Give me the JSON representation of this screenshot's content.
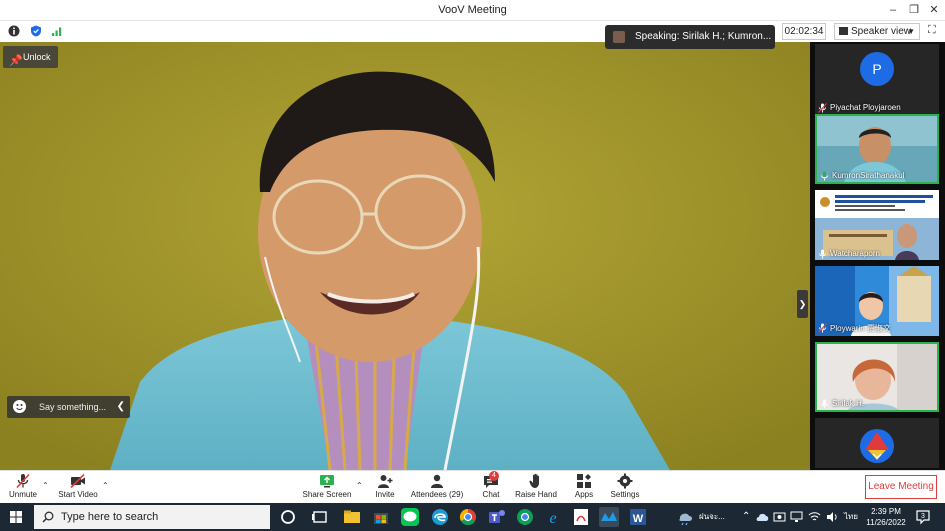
{
  "window": {
    "title": "VooV Meeting"
  },
  "topbar": {
    "speaking_text": "Speaking: Sirilak H.; Kumron...",
    "timer": "02:02:34",
    "view_mode": "Speaker view"
  },
  "main_video": {
    "unlock_label": "Unlock",
    "chat_placeholder": "Say something..."
  },
  "participants": [
    {
      "name": "Piyachat Ployjaroen",
      "avatar_letter": "P",
      "mic": "muted"
    },
    {
      "name": "KumronSirathanakul",
      "mic": "active"
    },
    {
      "name": "Watcharaporn",
      "mic": "on"
    },
    {
      "name": "Ploywarin 贾淑文",
      "mic": "muted"
    },
    {
      "name": "Sirilak H.",
      "mic": "on"
    },
    {
      "name": "",
      "mic": ""
    }
  ],
  "toolbar": {
    "unmute": "Unmute",
    "start_video": "Start Video",
    "share_screen": "Share Screen",
    "invite": "Invite",
    "attendees": "Attendees (29)",
    "chat": "Chat",
    "chat_badge": "4",
    "raise_hand": "Raise Hand",
    "apps": "Apps",
    "settings": "Settings",
    "leave": "Leave Meeting"
  },
  "taskbar": {
    "search_placeholder": "Type here to search",
    "weather": "ฝนจะ...",
    "time": "2:39 PM",
    "date": "11/26/2022",
    "lang": "ไทย",
    "notifications": "3"
  },
  "colors": {
    "accent_blue": "#1e6be6",
    "leave_red": "#e03a3a",
    "active_green": "#2bb24c",
    "video_bg": "#9c9220"
  }
}
